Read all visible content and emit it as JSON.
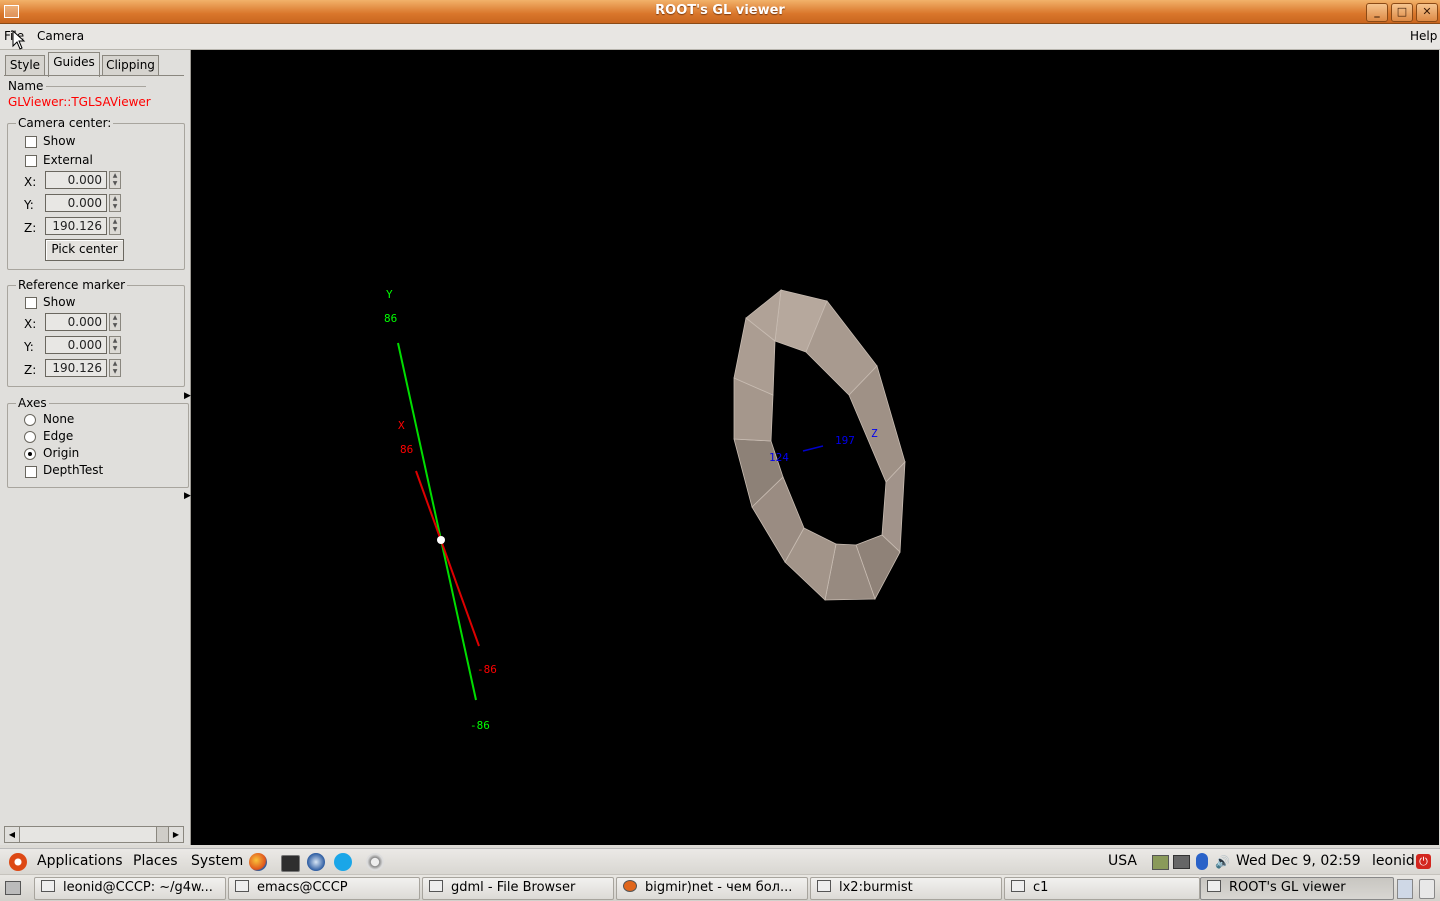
{
  "window": {
    "title": "ROOT's GL viewer",
    "controls": [
      "_",
      "□",
      "✕"
    ]
  },
  "menubar": {
    "file": "File",
    "camera": "Camera",
    "help": "Help"
  },
  "tabs": [
    "Style",
    "Guides",
    "Clipping"
  ],
  "active_tab": "Guides",
  "name_section": {
    "label": "Name",
    "value": "GLViewer::TGLSAViewer",
    "value_color": "#ff0000"
  },
  "camera_center": {
    "title": "Camera center:",
    "show_label": "Show",
    "external_label": "External",
    "x_label": "X:",
    "x": "0.000",
    "y_label": "Y:",
    "y": "0.000",
    "z_label": "Z:",
    "z": "190.126",
    "pick_button": "Pick center"
  },
  "reference_marker": {
    "title": "Reference marker",
    "show_label": "Show",
    "x_label": "X:",
    "x": "0.000",
    "y_label": "Y:",
    "y": "0.000",
    "z_label": "Z:",
    "z": "190.126"
  },
  "axes": {
    "title": "Axes",
    "none": "None",
    "edge": "Edge",
    "origin": "Origin",
    "depthtest": "DepthTest",
    "selected": "Origin"
  },
  "scene": {
    "background": "#000000",
    "y_axis": {
      "name": "Y",
      "max": "86",
      "min": "-86",
      "color": "#00ff00"
    },
    "x_axis": {
      "name": "X",
      "max": "86",
      "min": "-86",
      "color": "#ff0000"
    },
    "z_axis": {
      "name": "Z",
      "label_a": "124",
      "label_b": "197",
      "color": "#0000ff"
    },
    "shape_color": "#a8988c"
  },
  "gnome_panel": {
    "applications": "Applications",
    "places": "Places",
    "system": "System",
    "keyboard": "USA",
    "clock": "Wed Dec  9, 02:59",
    "user": "leonid"
  },
  "taskbar": [
    {
      "label": "leonid@CCCP: ~/g4w..."
    },
    {
      "label": "emacs@CCCP"
    },
    {
      "label": "gdml - File Browser"
    },
    {
      "label": "bigmir)net - чем бол..."
    },
    {
      "label": "lx2:burmist"
    },
    {
      "label": "c1"
    },
    {
      "label": "ROOT's GL viewer"
    }
  ]
}
